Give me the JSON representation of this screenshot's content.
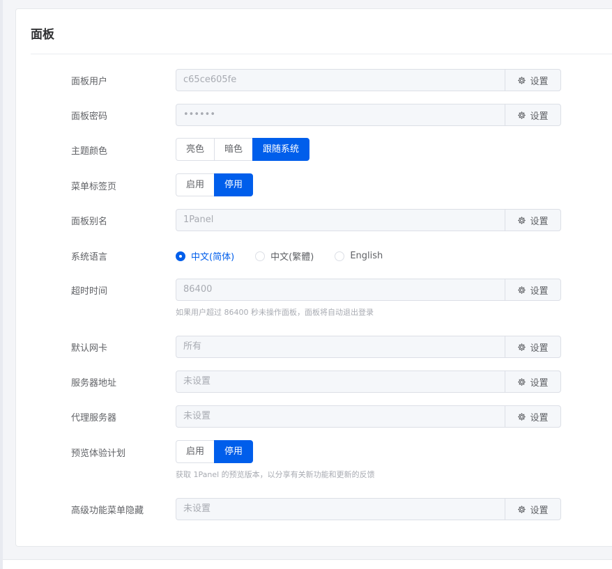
{
  "panel": {
    "title": "面板",
    "set_label": "设置",
    "user": {
      "label": "面板用户",
      "value": "c65ce605fe"
    },
    "password": {
      "label": "面板密码",
      "value": "••••••"
    },
    "theme": {
      "label": "主题颜色",
      "options": [
        "亮色",
        "暗色",
        "跟随系统"
      ],
      "selected": "跟随系统"
    },
    "menu_tabs": {
      "label": "菜单标签页",
      "options": [
        "启用",
        "停用"
      ],
      "selected": "停用"
    },
    "alias": {
      "label": "面板别名",
      "value": "1Panel"
    },
    "language": {
      "label": "系统语言",
      "options": [
        "中文(简体)",
        "中文(繁體)",
        "English"
      ],
      "selected": "中文(简体)"
    },
    "timeout": {
      "label": "超时时间",
      "value": "86400",
      "help": "如果用户超过 86400 秒未操作面板，面板将自动退出登录"
    },
    "nic": {
      "label": "默认网卡",
      "value": "所有"
    },
    "server_address": {
      "label": "服务器地址",
      "value": "未设置"
    },
    "proxy": {
      "label": "代理服务器",
      "value": "未设置"
    },
    "preview": {
      "label": "预览体验计划",
      "options": [
        "启用",
        "停用"
      ],
      "selected": "停用",
      "help": "获取 1Panel 的预览版本，以分享有关新功能和更新的反馈"
    },
    "hidden_menus": {
      "label": "高级功能菜单隐藏",
      "value": "未设置"
    }
  },
  "colors": {
    "primary": "#005eeb",
    "text": "#606266",
    "placeholder": "#a8abb2"
  }
}
